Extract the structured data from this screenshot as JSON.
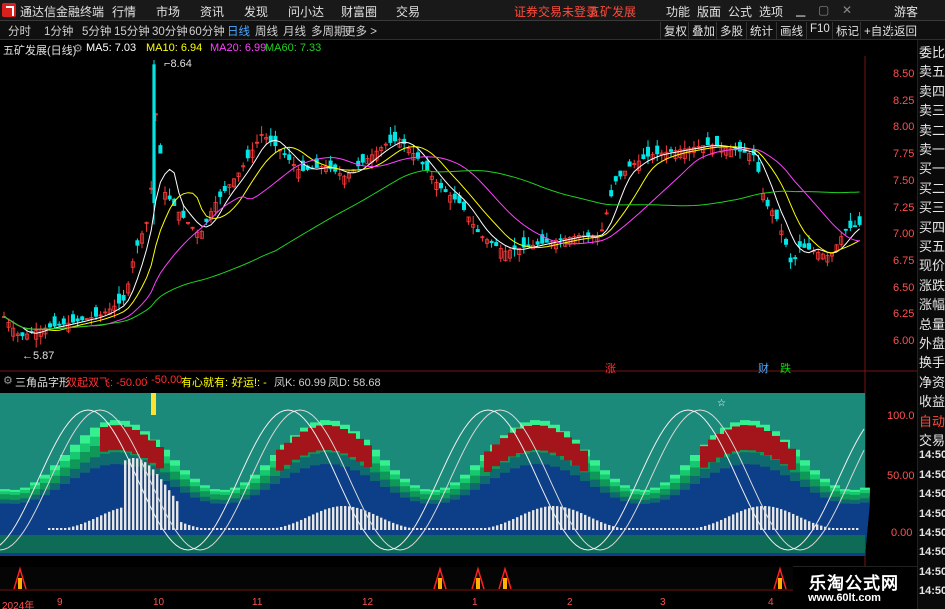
{
  "menubar": {
    "app_title": "通达信金融终端",
    "items": [
      "行情",
      "市场",
      "资讯",
      "发现",
      "问小达",
      "财富圈",
      "交易"
    ],
    "warning": "证券交易未登录",
    "stock_name": "五矿发展",
    "right_items": [
      "功能",
      "版面",
      "公式",
      "选项"
    ],
    "guest": "游客"
  },
  "toolbar": {
    "periods": [
      "分时",
      "1分钟",
      "5分钟",
      "15分钟",
      "30分钟",
      "60分钟",
      "日线",
      "周线",
      "月线",
      "多周期",
      "更多 >"
    ],
    "active_period": "日线",
    "buttons": [
      "复权",
      "叠加",
      "多股",
      "统计",
      "画线",
      "F10",
      "标记",
      "+自选",
      "返回"
    ]
  },
  "main_chart": {
    "title": "五矿发展(日线)",
    "ma_labels": [
      {
        "text": "MA5: 7.03",
        "color": "#ffffff"
      },
      {
        "text": "MA10: 6.94",
        "color": "#ffff00"
      },
      {
        "text": "MA20: 6.99",
        "color": "#ff40ff"
      },
      {
        "text": "MA60: 7.33",
        "color": "#20d020"
      }
    ],
    "high_label": "8.64",
    "low_label": "5.87",
    "price_axis": [
      "8.50",
      "8.25",
      "8.00",
      "7.75",
      "7.50",
      "7.25",
      "7.00",
      "6.75",
      "6.50",
      "6.25",
      "6.00"
    ],
    "markers": [
      {
        "text": "涨",
        "color": "#ff3030"
      },
      {
        "text": "财",
        "color": "#4aa8ff"
      },
      {
        "text": "跌",
        "color": "#00e000"
      }
    ]
  },
  "sub_chart": {
    "title": "三角品字形",
    "values": [
      {
        "text": "双起双飞: -50.00",
        "color": "#ff3030"
      },
      {
        "text": ": -50.00",
        "color": "#ff3030"
      },
      {
        "text": "有心就有: -",
        "color": "#ffff00"
      },
      {
        "text": "好运!: -",
        "color": "#ffff00"
      },
      {
        "text": "凤K: 60.99",
        "color": "#cfcfcf"
      },
      {
        "text": "凤D: 58.68",
        "color": "#cfcfcf"
      }
    ],
    "axis": [
      "100.0",
      "50.00",
      "0.00"
    ],
    "star": "☆"
  },
  "right_panel": {
    "labels": [
      "委比",
      "卖五",
      "卖四",
      "卖三",
      "卖二",
      "卖一",
      "买一",
      "买二",
      "买三",
      "买四",
      "买五",
      "现价",
      "涨跌",
      "涨幅",
      "总量",
      "外盘",
      "换手",
      "净资",
      "收益",
      "自动",
      "交易",
      "14:50",
      "14:50",
      "14:50",
      "14:50",
      "14:50",
      "14:50",
      "14:50",
      "14:50"
    ]
  },
  "date_axis": [
    "2024年",
    "9",
    "10",
    "11",
    "12",
    "1",
    "2",
    "3",
    "4"
  ],
  "watermark": {
    "title": "乐淘公式网",
    "url": "www.60lt.com"
  }
}
